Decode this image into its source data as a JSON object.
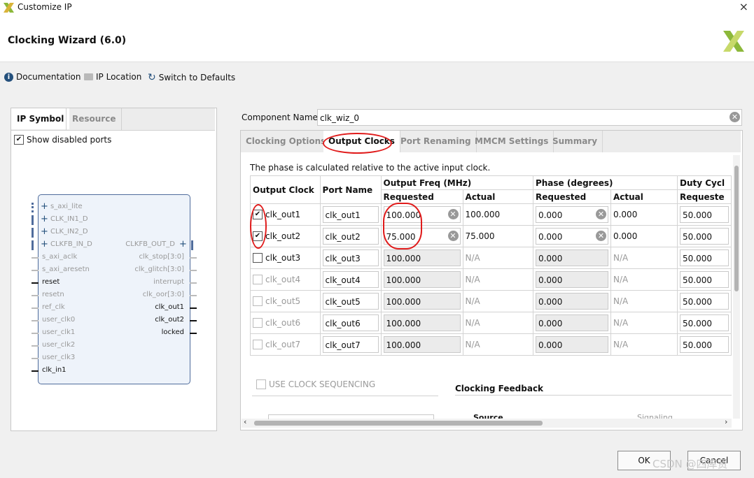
{
  "window": {
    "title": "Customize IP",
    "close_glyph": "×"
  },
  "header": {
    "title": "Clocking Wizard (6.0)"
  },
  "toolbar": {
    "documentation": "Documentation",
    "ip_location": "IP Location",
    "switch_defaults": "Switch to Defaults"
  },
  "left_panel": {
    "tabs": [
      "IP Symbol",
      "Resource"
    ],
    "show_disabled_ports": "Show disabled ports",
    "left_pins": [
      "s_axi_lite",
      "CLK_IN1_D",
      "CLK_IN2_D",
      "CLKFB_IN_D",
      "s_axi_aclk",
      "s_axi_aresetn",
      "reset",
      "resetn",
      "ref_clk",
      "user_clk0",
      "user_clk1",
      "user_clk2",
      "user_clk3",
      "clk_in1"
    ],
    "right_pins": [
      "CLKFB_OUT_D",
      "clk_stop[3:0]",
      "clk_glitch[3:0]",
      "interrupt",
      "clk_oor[3:0]",
      "clk_out1",
      "clk_out2",
      "locked"
    ]
  },
  "component": {
    "label": "Component Name",
    "value": "clk_wiz_0"
  },
  "tabs": [
    "Clocking Options",
    "Output Clocks",
    "Port Renaming",
    "MMCM Settings",
    "Summary"
  ],
  "note": "The phase is calculated relative to the active input clock.",
  "table": {
    "headers": {
      "output_clock": "Output Clock",
      "port_name": "Port Name",
      "freq": "Output Freq (MHz)",
      "phase": "Phase (degrees)",
      "duty": "Duty Cycl",
      "requested": "Requested",
      "actual": "Actual",
      "duty_requested": "Requeste"
    },
    "rows": [
      {
        "name": "clk_out1",
        "port": "clk_out1",
        "freq_req": "100.000",
        "freq_act": "100.000",
        "phase_req": "0.000",
        "phase_act": "0.000",
        "duty": "50.000",
        "checked": "✔"
      },
      {
        "name": "clk_out2",
        "port": "clk_out2",
        "freq_req": "75.000",
        "freq_act": "75.000",
        "phase_req": "0.000",
        "phase_act": "0.000",
        "duty": "50.000",
        "checked": "✔"
      },
      {
        "name": "clk_out3",
        "port": "clk_out3",
        "freq_req": "100.000",
        "freq_act": "N/A",
        "phase_req": "0.000",
        "phase_act": "N/A",
        "duty": "50.000",
        "checked": ""
      },
      {
        "name": "clk_out4",
        "port": "clk_out4",
        "freq_req": "100.000",
        "freq_act": "N/A",
        "phase_req": "0.000",
        "phase_act": "N/A",
        "duty": "50.000",
        "checked": ""
      },
      {
        "name": "clk_out5",
        "port": "clk_out5",
        "freq_req": "100.000",
        "freq_act": "N/A",
        "phase_req": "0.000",
        "phase_act": "N/A",
        "duty": "50.000",
        "checked": ""
      },
      {
        "name": "clk_out6",
        "port": "clk_out6",
        "freq_req": "100.000",
        "freq_act": "N/A",
        "phase_req": "0.000",
        "phase_act": "N/A",
        "duty": "50.000",
        "checked": ""
      },
      {
        "name": "clk_out7",
        "port": "clk_out7",
        "freq_req": "100.000",
        "freq_act": "N/A",
        "phase_req": "0.000",
        "phase_act": "N/A",
        "duty": "50.000",
        "checked": ""
      }
    ]
  },
  "lower": {
    "use_clock_sequencing": "USE CLOCK SEQUENCING",
    "clocking_feedback": "Clocking Feedback",
    "source": "Source",
    "signaling": "Signaling"
  },
  "buttons": {
    "ok": "OK",
    "cancel": "Cancel"
  },
  "watermark": "CSDN @四库贤",
  "colors": {
    "annotation": "#e01b1b",
    "logo": "#8cb83a"
  }
}
